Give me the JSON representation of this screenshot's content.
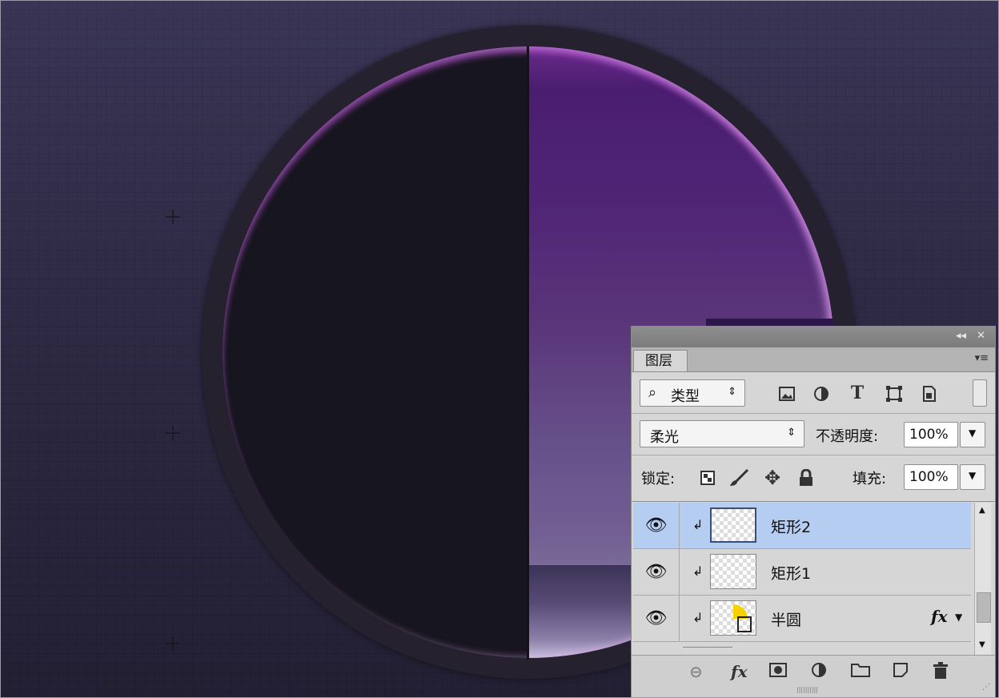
{
  "panel": {
    "title_buttons": {
      "collapse": "◂◂",
      "close": "✕"
    },
    "tab_label": "图层",
    "menu_icon": "▾≡",
    "filter": {
      "label": "类型",
      "icons": [
        "image-icon",
        "adjustment-icon",
        "type-icon",
        "shape-icon",
        "smart-object-icon"
      ]
    },
    "blend_mode": "柔光",
    "opacity_label": "不透明度:",
    "opacity_value": "100%",
    "lock_label": "锁定:",
    "fill_label": "填充:",
    "fill_value": "100%",
    "layers": [
      {
        "name": "矩形2",
        "selected": true
      },
      {
        "name": "矩形1",
        "selected": false
      },
      {
        "name": "半圆",
        "selected": false,
        "fx": "fx"
      }
    ]
  },
  "colors": {
    "accent_purple": "#4f2475",
    "panel_bg": "#d6d6d6",
    "selection": "#b6cdf2"
  }
}
